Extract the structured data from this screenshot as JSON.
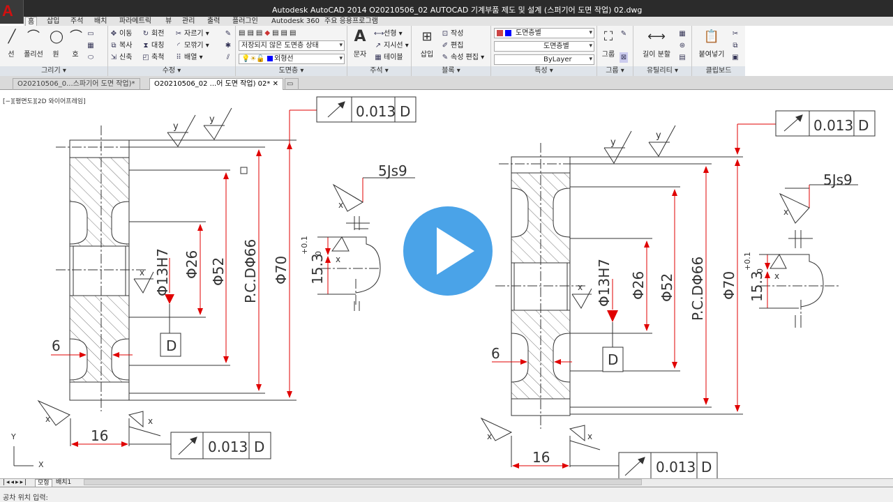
{
  "window": {
    "title": "Autodesk AutoCAD 2014    O20210506_02 AUTOCAD 기계부품 제도 및 설계 (스퍼기어 도면 작업) 02.dwg"
  },
  "ribbon_tabs": [
    "홈",
    "삽입",
    "주석",
    "배치",
    "파라메트릭",
    "뷰",
    "관리",
    "출력",
    "플러그인",
    "Autodesk 360",
    "주요 응용프로그램"
  ],
  "panels": {
    "draw": {
      "label": "그리기",
      "line": "선",
      "polyline": "폴리선",
      "circle": "원",
      "arc": "호"
    },
    "modify": {
      "label": "수정",
      "move": "이동",
      "rotate": "회전",
      "trim": "자르기",
      "copy": "복사",
      "mirror": "대칭",
      "fillet": "모깎기",
      "stretch": "신축",
      "scale": "축척",
      "array": "배열"
    },
    "layers": {
      "label": "도면층",
      "state": "저장되지 않은 도면층 상태",
      "current": "외형선"
    },
    "annotation": {
      "label": "주석",
      "text": "문자",
      "linear": "선형",
      "leader": "지시선",
      "table": "테이블"
    },
    "block": {
      "label": "블록",
      "insert": "삽입",
      "create": "작성",
      "edit": "편집",
      "attr": "속성 편집"
    },
    "properties": {
      "label": "특성",
      "color": "도면층별",
      "linetype": "도면층별",
      "lineweight": "ByLayer"
    },
    "groups": {
      "label": "그룹",
      "group": "그룹"
    },
    "utilities": {
      "label": "유틸리티",
      "measure": "길이 분할"
    },
    "clipboard": {
      "label": "클립보드",
      "paste": "붙여넣기"
    }
  },
  "doc_tabs": [
    "O20210506_0...스파기어 도면 작업)*",
    "O20210506_02 ...어 도면 작업) 02*"
  ],
  "viewport_label": "[−][평면도][2D 와이어프레임]",
  "layout_tabs": [
    "모형",
    "배치1"
  ],
  "command_prompt": "공차 위치 입력:",
  "drawing": {
    "tol_value": "0.013",
    "datum": "D",
    "keyway": "5Js9",
    "keydepth": "15.3",
    "keytol_upper": "+0.1",
    "keytol_lower": "0",
    "bore": "Φ13H7",
    "hub": "Φ26",
    "root": "Φ52",
    "pcd": "P.C.DΦ66",
    "outside": "Φ70",
    "groove": "6",
    "width": "16",
    "surf": "y",
    "surf_x": "x",
    "axis_y": "Y",
    "axis_x": "X"
  },
  "colors": {
    "dim": "#d00000",
    "title_bg": "#2b2b2b",
    "play": "#4aa3e8"
  }
}
